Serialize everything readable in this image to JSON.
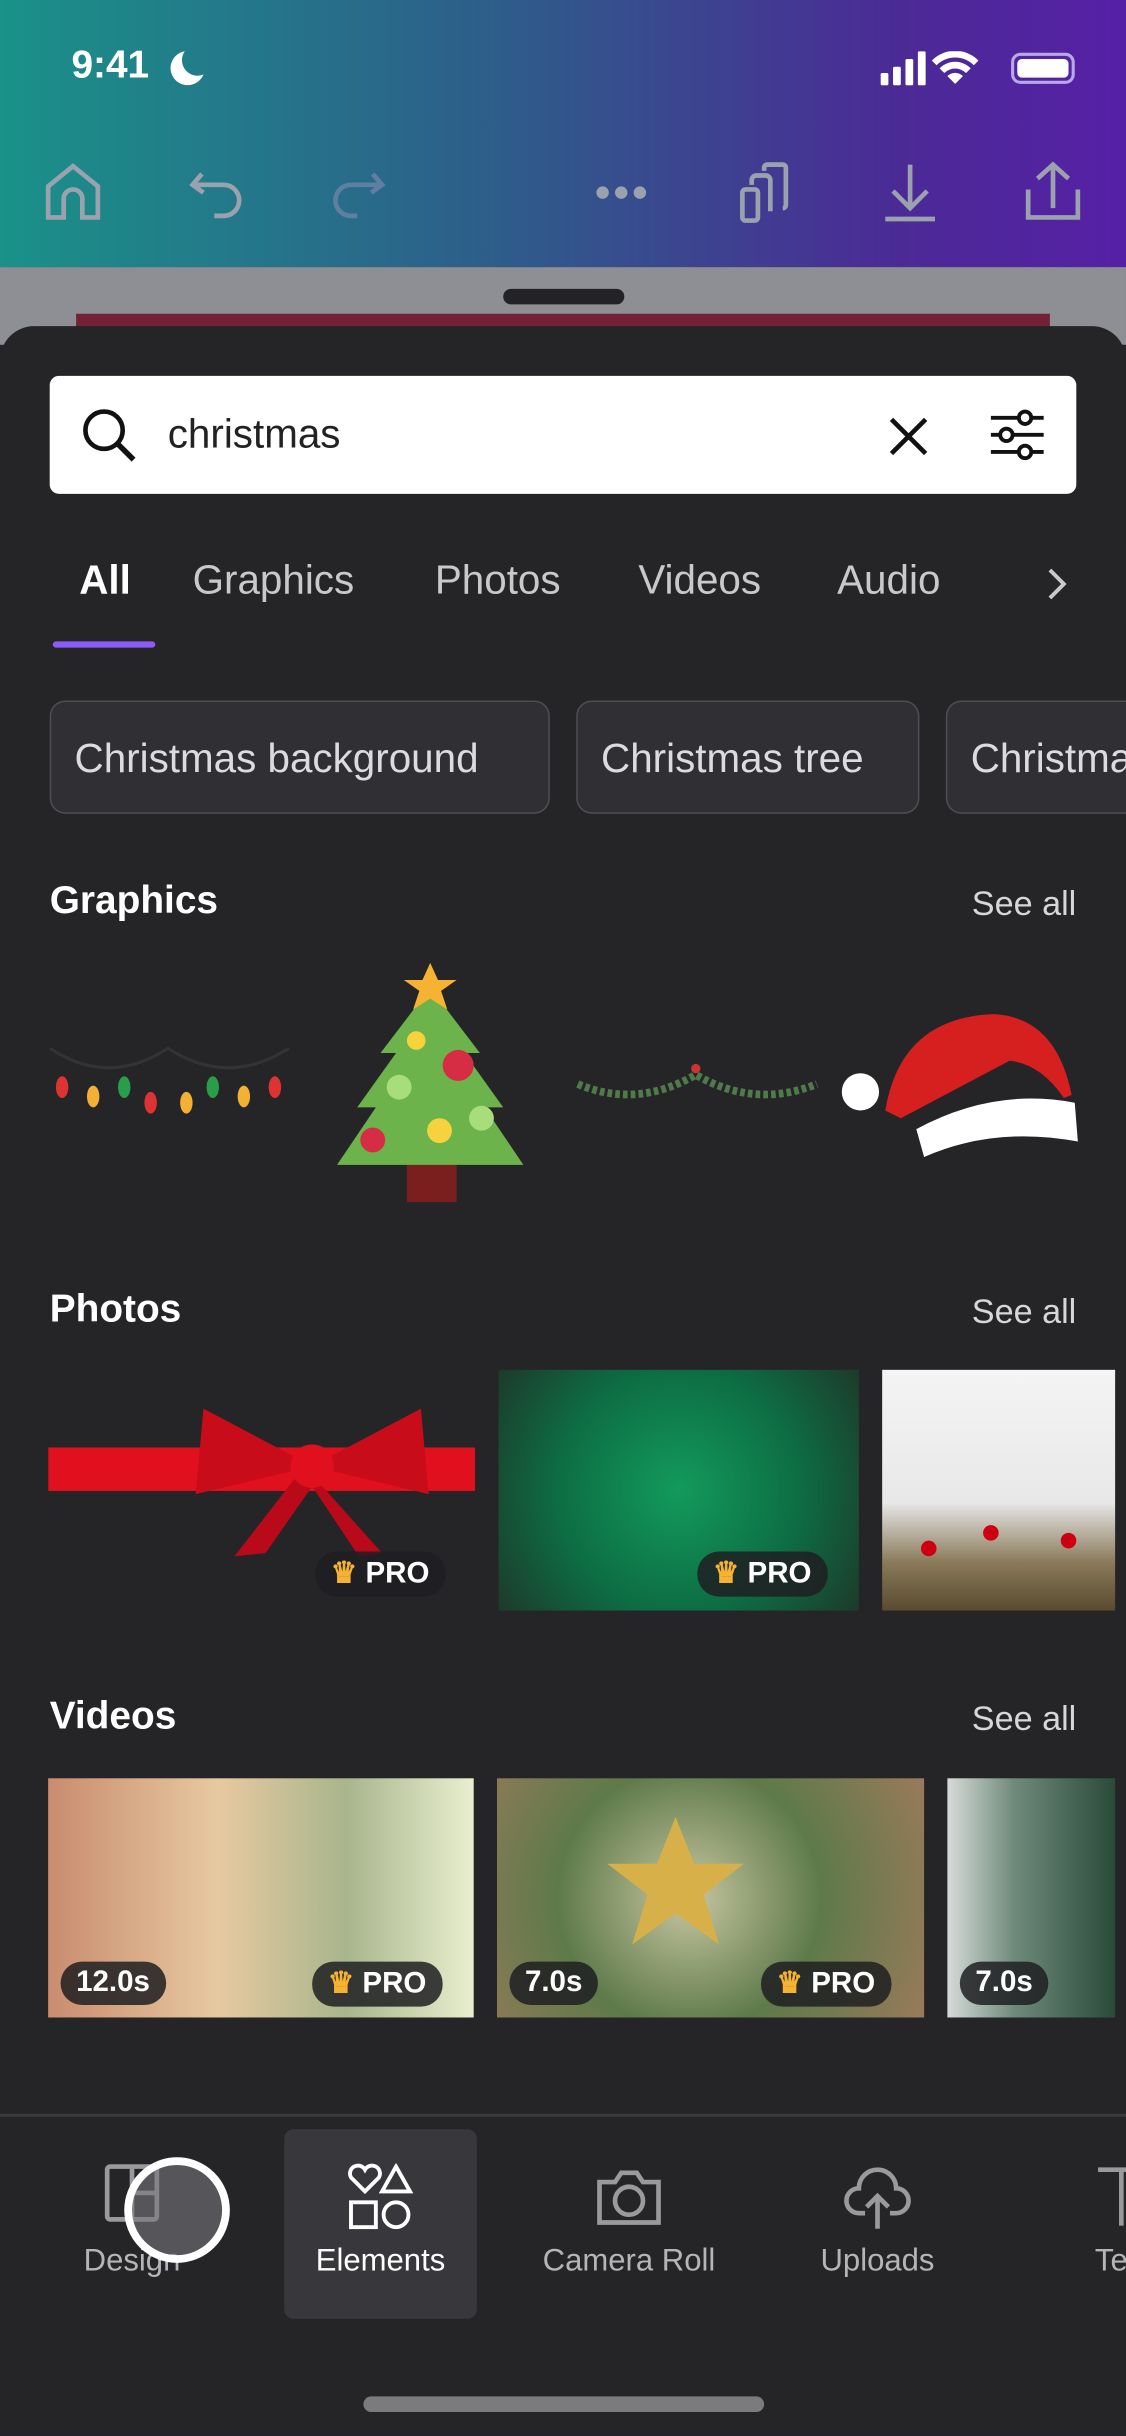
{
  "status_bar": {
    "time": "9:41"
  },
  "toolbar": {
    "icons": [
      "home-icon",
      "undo-icon",
      "redo-icon",
      "more-icon",
      "pages-icon",
      "download-icon",
      "share-icon"
    ]
  },
  "search": {
    "value": "christmas",
    "icons": [
      "search-icon",
      "clear-icon",
      "filter-icon"
    ]
  },
  "tabs": [
    {
      "label": "All",
      "active": true
    },
    {
      "label": "Graphics"
    },
    {
      "label": "Photos"
    },
    {
      "label": "Videos"
    },
    {
      "label": "Audio"
    }
  ],
  "suggestions": [
    "Christmas background",
    "Christmas tree",
    "Christmas"
  ],
  "sections": {
    "graphics": {
      "title": "Graphics",
      "see_all": "See all"
    },
    "photos": {
      "title": "Photos",
      "see_all": "See all",
      "badges": [
        "PRO",
        "PRO"
      ]
    },
    "videos": {
      "title": "Videos",
      "see_all": "See all",
      "items": [
        {
          "duration": "12.0s",
          "badge": "PRO"
        },
        {
          "duration": "7.0s",
          "badge": "PRO"
        },
        {
          "duration": "7.0s"
        }
      ]
    }
  },
  "bottom_nav": [
    {
      "label": "Design"
    },
    {
      "label": "Elements",
      "active": true
    },
    {
      "label": "Camera Roll"
    },
    {
      "label": "Uploads"
    },
    {
      "label": "Te"
    }
  ],
  "colors": {
    "accent": "#8b5cf6",
    "sheet": "#252528"
  }
}
